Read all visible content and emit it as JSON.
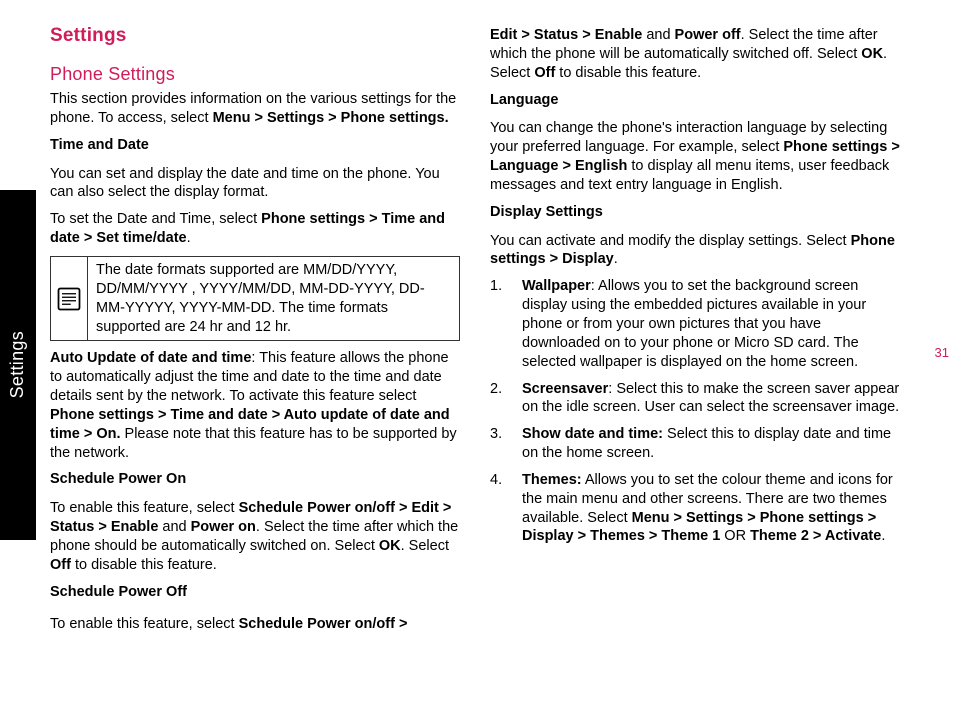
{
  "sidebar": {
    "label": "Settings"
  },
  "pageNumber": "31",
  "col1": {
    "title": "Settings",
    "section": "Phone Settings",
    "intro_a": "This section provides information on the various settings for the phone. To access, select ",
    "intro_b": "Menu > Settings > Phone settings.",
    "timeDateHeader": "Time and Date",
    "timeDate_p1": "You can set and display the date and time on the phone. You can also select the display format.",
    "timeDate_p2a": "To set the Date and Time, select ",
    "timeDate_p2b": "Phone settings > Time and date > Set time/date",
    "timeDate_p2c": ".",
    "noteText": "The date formats supported are MM/DD/YYYY, DD/MM/YYYY , YYYY/MM/DD, MM-DD-YYYY, DD-MM-YYYYY, YYYY-MM-DD. The time formats supported are 24 hr and 12 hr.",
    "auto_a": "Auto Update of date and time",
    "auto_b": ": This feature allows the phone to automatically adjust the time and date to the time and date details sent by the network. To activate this feature select ",
    "auto_c": "Phone settings > Time and date > Auto update of date and time > On.",
    "auto_d": " Please note that this feature has to be supported by the network.",
    "schedOnHeader": "Schedule Power On",
    "schedOn_a": "To enable this feature, select ",
    "schedOn_b": "Schedule Power on/off > Edit > Status > Enable",
    "schedOn_c": " and ",
    "schedOn_d": "Power on",
    "schedOn_e": ". Select the time after which the phone should be automatically switched on. Select ",
    "schedOn_f": "OK",
    "schedOn_g": ". Select ",
    "schedOn_h": "Off",
    "schedOn_i": " to disable this feature.",
    "schedOffHeader": "Schedule Power Off",
    "schedOff_a": "To enable this feature, select ",
    "schedOff_b": "Schedule Power on/off > "
  },
  "col2": {
    "cont_a": "Edit > Status > Enable",
    "cont_b": " and ",
    "cont_c": "Power off",
    "cont_d": ". Select the time after which the phone will be automatically switched off. Select ",
    "cont_e": "OK",
    "cont_f": ". Select ",
    "cont_g": "Off",
    "cont_h": " to disable this feature.",
    "langHeader": "Language",
    "lang_a": "You can change the phone's interaction language by selecting your preferred language. For example, select ",
    "lang_b": "Phone settings > Language > English",
    "lang_c": " to display all menu items, user feedback messages and text entry language in English.",
    "dispHeader": "Display Settings",
    "disp_a": "You can activate and modify the display settings. Select ",
    "disp_b": "Phone settings > Display",
    "disp_c": ".",
    "li1_a": "Wallpaper",
    "li1_b": ": Allows you to set the background screen display using the embedded pictures available in your phone or from your own pictures that you have downloaded on to your phone or Micro SD card. The selected wallpaper is displayed on the home screen.",
    "li2_a": "Screensaver",
    "li2_b": ": Select this to make the screen saver appear on the idle screen. User can select the screensaver image.",
    "li3_a": "Show date and time:",
    "li3_b": " Select this to display date and time on the home screen.",
    "li4_a": "Themes:",
    "li4_b": " Allows you to set the colour theme and icons for the main menu and other screens. There are two themes available. Select ",
    "li4_c": "Menu > Settings > Phone settings > Display > Themes > Theme 1",
    "li4_d": " OR ",
    "li4_e": "Theme 2 > Activate",
    "li4_f": "."
  }
}
